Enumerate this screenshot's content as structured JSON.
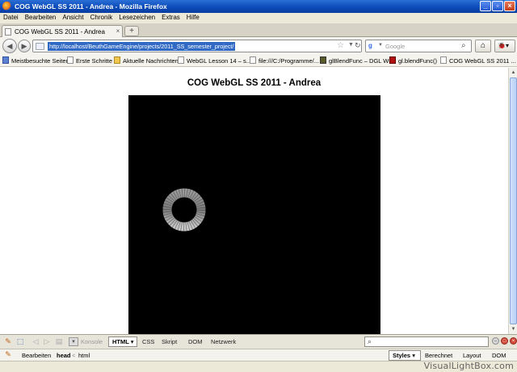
{
  "window": {
    "title": "COG WebGL SS 2011 - Andrea - Mozilla Firefox"
  },
  "menu": [
    "Datei",
    "Bearbeiten",
    "Ansicht",
    "Chronik",
    "Lesezeichen",
    "Extras",
    "Hilfe"
  ],
  "tab": {
    "label": "COG WebGL SS 2011 - Andrea",
    "close": "×",
    "new": "+"
  },
  "nav": {
    "url": "http://localhost/BeuthGameEngine/projects/2011_SS_semester_project/",
    "search_placeholder": "Google"
  },
  "bookmarks": [
    "Meistbesuchte Seiten",
    "Erste Schritte",
    "Aktuelle Nachrichten",
    "WebGL Lesson 14 – s...",
    "file:///C:/Programme/...",
    "glBlendFunc – DGL Wiki",
    "gl.blendFunc()",
    "COG WebGL SS 2011 ..."
  ],
  "page": {
    "heading": "COG WebGL SS 2011 - Andrea"
  },
  "firebug": {
    "tabs": [
      "Konsole",
      "HTML",
      "CSS",
      "Skript",
      "DOM",
      "Netzwerk"
    ],
    "active_tab": "HTML",
    "edit_label": "Bearbeiten",
    "breadcrumb_head": "head",
    "breadcrumb_sep": "<",
    "breadcrumb_html": "html",
    "side_tabs": [
      "Styles",
      "Berechnet",
      "Layout",
      "DOM"
    ],
    "active_side_tab": "Styles"
  },
  "watermark": "VisualLightBox.com",
  "colors": {
    "titlebar": "#0a49b7",
    "chrome": "#ece9d8",
    "canvas": "#000000",
    "selection": "#316ac5"
  }
}
